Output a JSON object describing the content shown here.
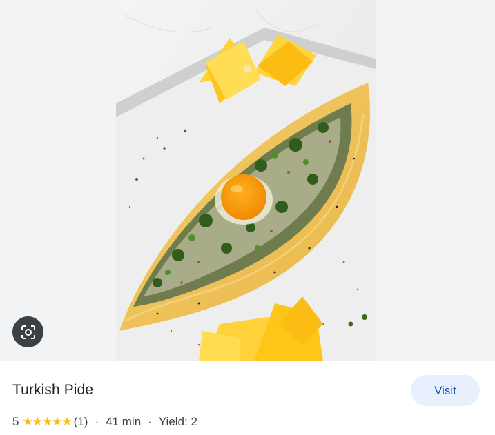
{
  "result": {
    "title": "Turkish Pide",
    "rating": "5",
    "stars": 5,
    "stars_text": "★★★★★",
    "review_count": "(1)",
    "separator": "·",
    "time": "41 min",
    "yield": "Yield: 2",
    "visit_label": "Visit"
  },
  "icons": {
    "lens": "google-lens-icon"
  },
  "colors": {
    "star": "#fbbc04",
    "visit_bg": "#e8f0fe",
    "visit_text": "#0b57d0",
    "lens_bg": "#3c4043"
  }
}
